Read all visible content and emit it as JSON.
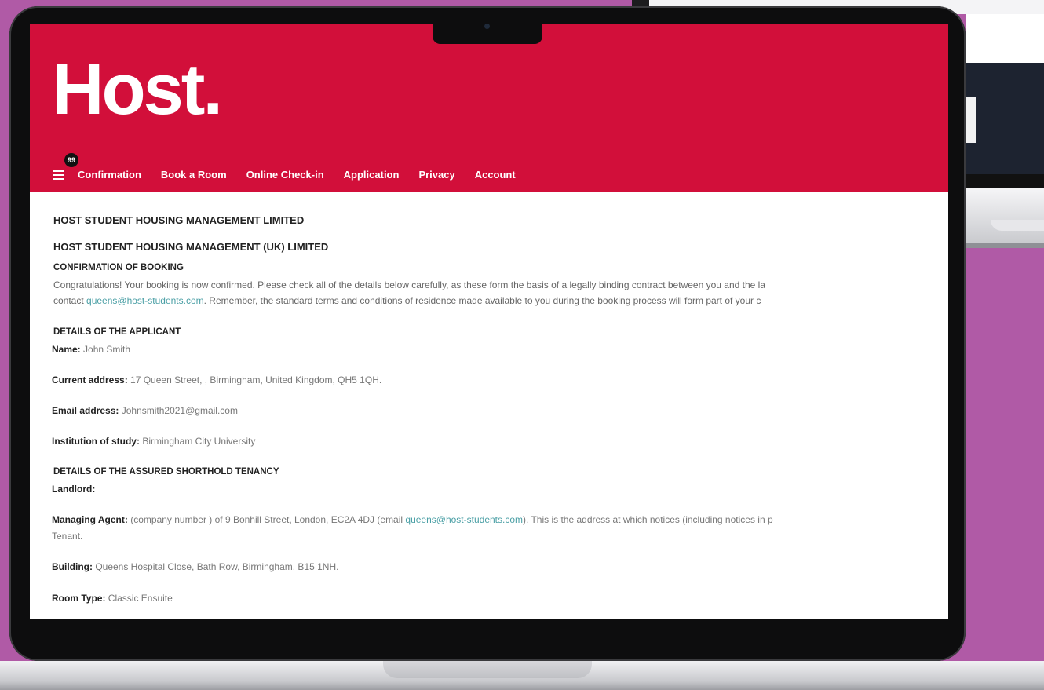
{
  "site": {
    "logo": "Host.",
    "badge_count": "99",
    "brand_color": "#d20f3a",
    "nav": [
      "Confirmation",
      "Book a Room",
      "Online Check-in",
      "Application",
      "Privacy",
      "Account"
    ]
  },
  "document": {
    "company_1": "HOST STUDENT HOUSING MANAGEMENT LIMITED",
    "company_2": "HOST STUDENT HOUSING MANAGEMENT (UK) LIMITED",
    "confirmation_title": "CONFIRMATION OF BOOKING",
    "confirmation_line1": "Congratulations! Your booking is now confirmed. Please check all of the details below carefully, as these form the basis of a legally binding contract between you and the la",
    "confirmation_line2_pre": "contact ",
    "confirmation_email": "queens@host-students.com",
    "confirmation_line2_post": ". Remember, the standard terms and conditions of residence made available to you during the booking process will form part of your c",
    "applicant_title": "DETAILS OF THE APPLICANT",
    "name_label": "Name:",
    "name_value": " John Smith",
    "address_label": "Current address:",
    "address_value": " 17 Queen Street, , Birmingham, United Kingdom, QH5 1QH.",
    "email_label": "Email address:",
    "email_value": " Johnsmith2021@gmail.com",
    "institution_label": "Institution of study:",
    "institution_value": " Birmingham City University",
    "tenancy_title": "DETAILS OF THE ASSURED SHORTHOLD TENANCY",
    "landlord_label": "Landlord:",
    "agent_label": "Managing Agent:",
    "agent_value_pre": " (company number ) of 9 Bonhill Street, London, EC2A 4DJ (email ",
    "agent_email": "queens@host-students.com",
    "agent_value_post": "). This is the address at which notices (including notices in p",
    "agent_line2": "Tenant.",
    "building_label": "Building:",
    "building_value": " Queens Hospital Close, Bath Row, Birmingham, B15 1NH.",
    "room_label": "Room Type:",
    "room_value": " Classic Ensuite"
  }
}
